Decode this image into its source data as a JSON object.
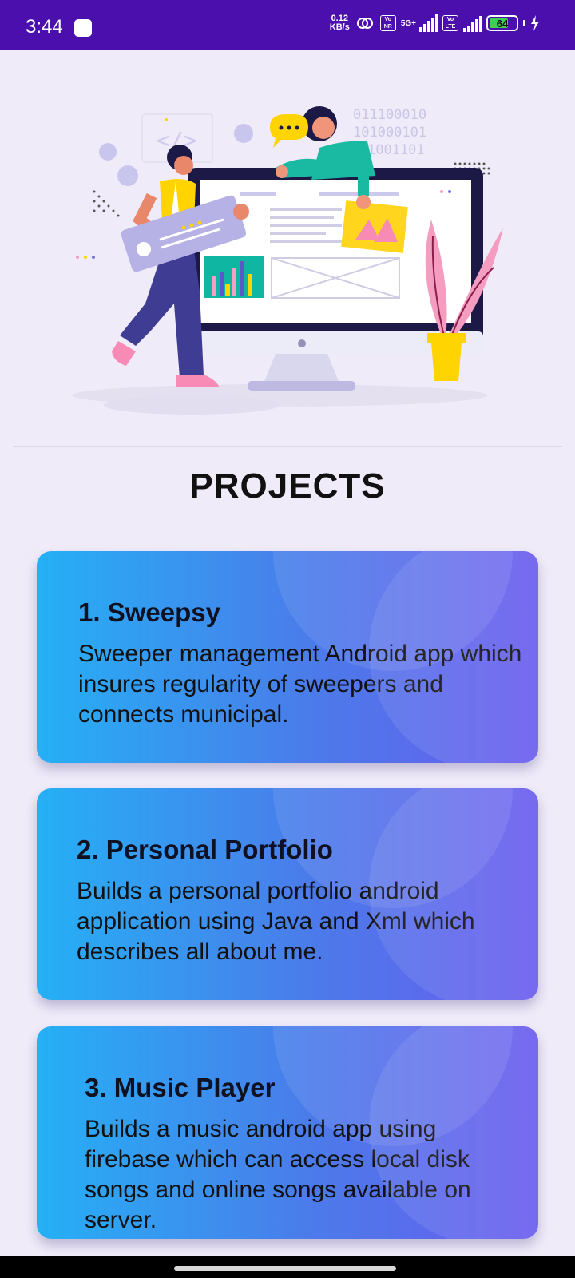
{
  "status_bar": {
    "time": "3:44",
    "net_speed_value": "0.12",
    "net_speed_unit": "KB/s",
    "volte_badge_1": "Vo NR",
    "network_type": "5G+",
    "volte_badge_2": "Vo LTE",
    "battery_level": "64",
    "battery_percent": 64,
    "background_color": "#4b0fad"
  },
  "hero": {
    "binary_lines": [
      "011100010",
      "101000101",
      "1001101"
    ]
  },
  "page": {
    "title": "PROJECTS",
    "background_color": "#efebf9"
  },
  "projects": [
    {
      "title": "1. Sweepsy",
      "description": "Sweeper management Android app which insures regularity of sweepers and connects municipal."
    },
    {
      "title": "2. Personal Portfolio",
      "description": "Builds a personal portfolio android application using Java and Xml which describes all about me."
    },
    {
      "title": "3. Music Player",
      "description": "Builds a music android app using firebase which can access local disk songs and online songs available on server."
    }
  ],
  "colors": {
    "card_gradient_start": "#25b0f5",
    "card_gradient_end": "#6a5cee"
  }
}
